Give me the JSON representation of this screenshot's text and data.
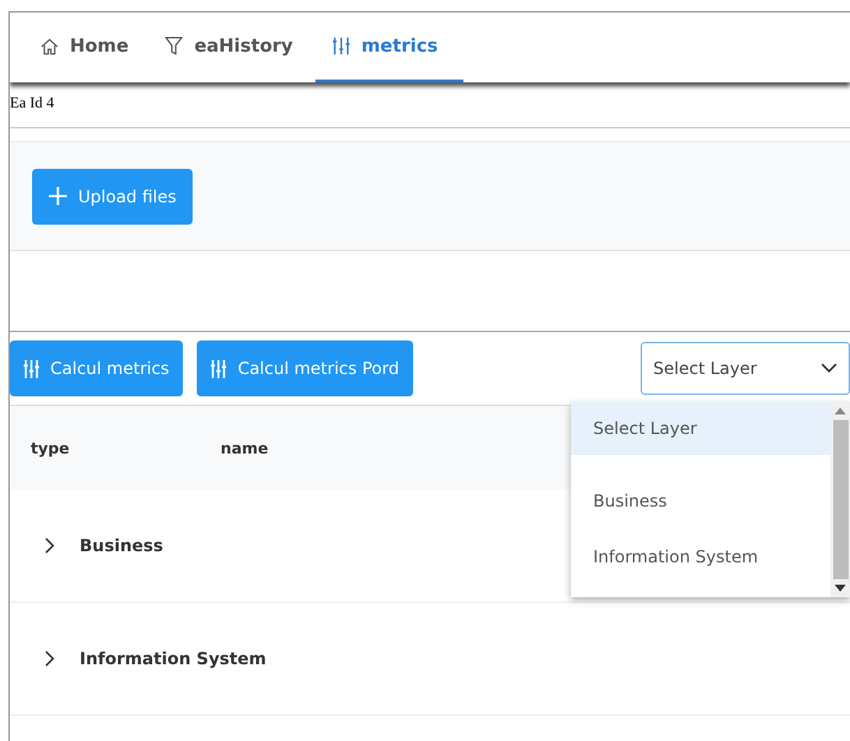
{
  "tabs": [
    {
      "label": "Home",
      "kind": "home",
      "selected": false
    },
    {
      "label": "eaHistory",
      "kind": "filter",
      "selected": false
    },
    {
      "label": "metrics",
      "kind": "metrics",
      "selected": true
    }
  ],
  "ea_id": "Ea Id 4",
  "upload_button": "Upload files",
  "action_buttons": [
    "Calcul metrics",
    "Calcul metrics Pord"
  ],
  "layer_select": {
    "value": "Select Layer",
    "expanded": true,
    "options": [
      {
        "label": "Select Layer",
        "selected": true
      },
      {
        "label": "Business",
        "selected": false
      },
      {
        "label": "Information System",
        "selected": false
      }
    ]
  },
  "table": {
    "columns": [
      "type",
      "name"
    ],
    "rows": [
      {
        "label": "Business",
        "expanded": false
      },
      {
        "label": "Information System",
        "expanded": false
      }
    ]
  }
}
